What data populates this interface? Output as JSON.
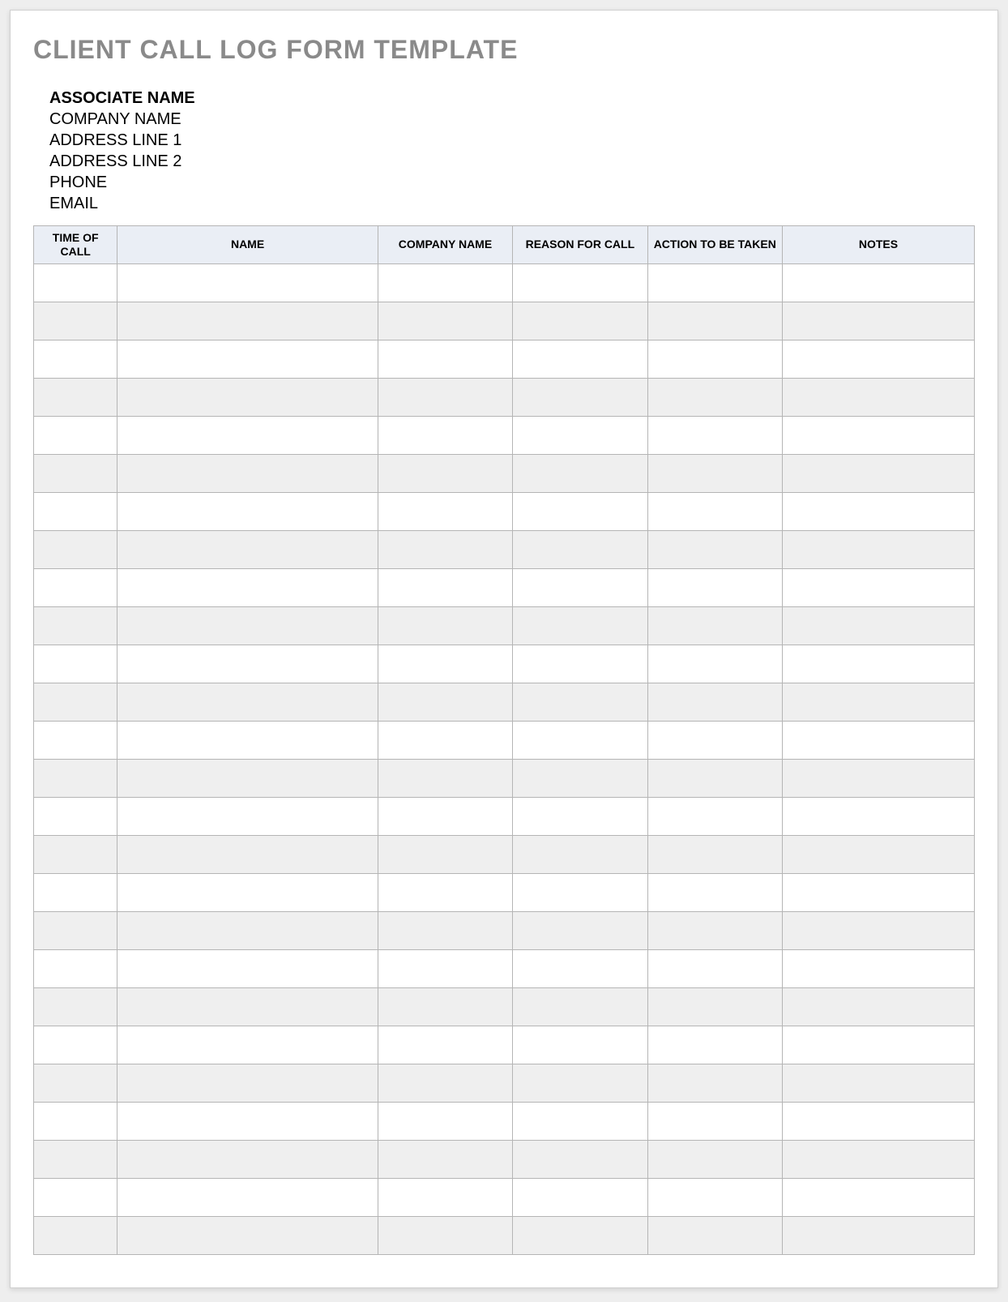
{
  "title": "CLIENT CALL LOG FORM TEMPLATE",
  "info": {
    "associate_name": "ASSOCIATE NAME",
    "company_name": "COMPANY NAME",
    "address_line_1": "ADDRESS LINE 1",
    "address_line_2": "ADDRESS LINE 2",
    "phone": "PHONE",
    "email": "EMAIL"
  },
  "columns": {
    "time_of_call": "TIME OF CALL",
    "name": "NAME",
    "company_name": "COMPANY NAME",
    "reason_for_call": "REASON FOR CALL",
    "action_to_be_taken": "ACTION TO BE TAKEN",
    "notes": "NOTES"
  },
  "row_count": 26,
  "rows": []
}
